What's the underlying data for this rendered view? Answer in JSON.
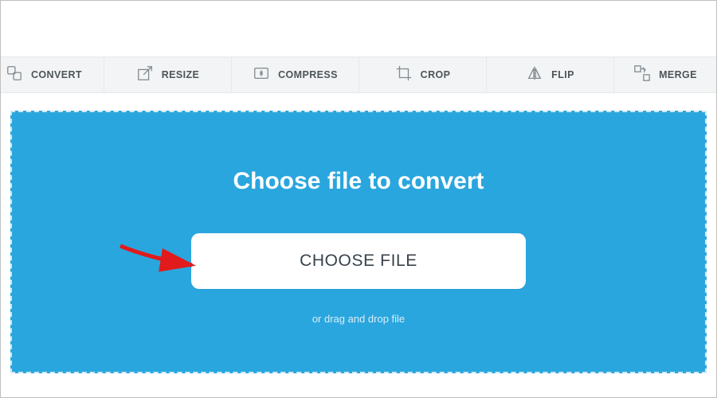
{
  "toolbar": {
    "items": [
      {
        "label": "CONVERT",
        "icon": "convert-icon"
      },
      {
        "label": "RESIZE",
        "icon": "resize-icon"
      },
      {
        "label": "COMPRESS",
        "icon": "compress-icon"
      },
      {
        "label": "CROP",
        "icon": "crop-icon"
      },
      {
        "label": "FLIP",
        "icon": "flip-icon"
      },
      {
        "label": "MERGE",
        "icon": "merge-icon"
      }
    ]
  },
  "stage": {
    "headline": "Choose file to convert",
    "button_label": "CHOOSE FILE",
    "hint": "or drag and drop file"
  }
}
